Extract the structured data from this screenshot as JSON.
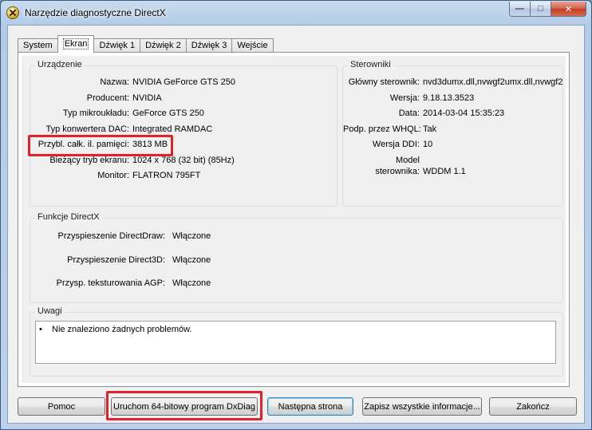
{
  "window": {
    "title": "Narzędzie diagnostyczne DirectX",
    "minimize_glyph": "—",
    "maximize_glyph": "□",
    "close_glyph": "✕"
  },
  "tabs": [
    {
      "label": "System"
    },
    {
      "label": "Ekran"
    },
    {
      "label": "Dźwięk 1"
    },
    {
      "label": "Dźwięk 2"
    },
    {
      "label": "Dźwięk 3"
    },
    {
      "label": "Wejście"
    }
  ],
  "device": {
    "legend": "Urządzenie",
    "rows": [
      {
        "label": "Nazwa:",
        "value": "NVIDIA GeForce GTS 250"
      },
      {
        "label": "Producent:",
        "value": "NVIDIA"
      },
      {
        "label": "Typ mikroukładu:",
        "value": "GeForce GTS 250"
      },
      {
        "label": "Typ konwertera DAC:",
        "value": "Integrated RAMDAC"
      },
      {
        "label": "Przybl. całk. il. pamięci:",
        "value": "3813 MB"
      },
      {
        "label": "Bieżący tryb ekranu:",
        "value": "1024 x 768 (32 bit) (85Hz)"
      },
      {
        "label": "Monitor:",
        "value": "FLATRON 795FT"
      }
    ]
  },
  "drivers": {
    "legend": "Sterowniki",
    "rows": [
      {
        "label": "Główny sterownik:",
        "value": "nvd3dumx.dll,nvwgf2umx.dll,nvwgf2"
      },
      {
        "label": "Wersja:",
        "value": "9.18.13.3523"
      },
      {
        "label": "Data:",
        "value": "2014-03-04 15:35:23"
      },
      {
        "label": "Podp. przez WHQL:",
        "value": "Tak"
      },
      {
        "label": "Wersja DDI:",
        "value": "10"
      },
      {
        "label": "Model",
        "label2": "sterownika:",
        "value": "WDDM 1.1"
      }
    ]
  },
  "features": {
    "legend": "Funkcje DirectX",
    "rows": [
      {
        "label": "Przyspieszenie DirectDraw:",
        "value": "Włączone"
      },
      {
        "label": "Przyspieszenie Direct3D:",
        "value": "Włączone"
      },
      {
        "label": "Przysp. teksturowania AGP:",
        "value": "Włączone"
      }
    ]
  },
  "notes": {
    "legend": "Uwagi",
    "bullet": "•",
    "items": [
      "Nie znaleziono żadnych problemów."
    ]
  },
  "buttons": {
    "help": "Pomoc",
    "run64": "Uruchom 64-bitowy program DxDiag",
    "next": "Następna strona",
    "save": "Zapisz wszystkie informacje...",
    "exit": "Zakończ"
  },
  "colors": {
    "highlight": "#e0222c",
    "title_gradient_top": "#c9dcef",
    "close_button": "#c13c24"
  }
}
